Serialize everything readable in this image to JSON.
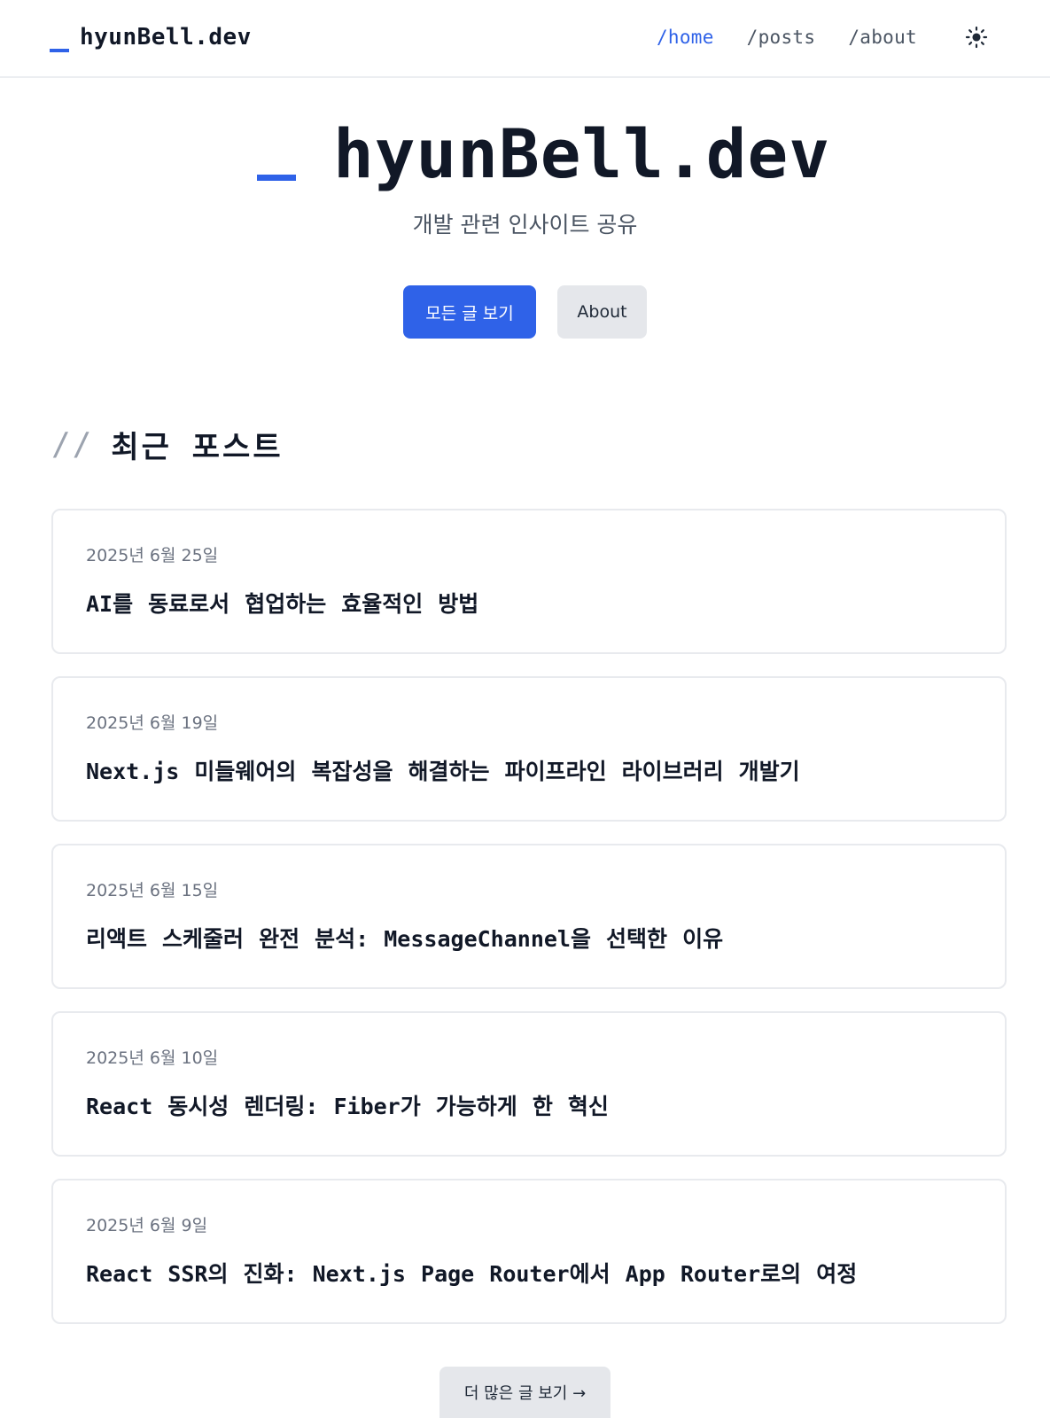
{
  "header": {
    "logo_text": "hyunBell.dev",
    "nav": [
      {
        "label": "/home",
        "active": true
      },
      {
        "label": "/posts",
        "active": false
      },
      {
        "label": "/about",
        "active": false
      }
    ],
    "theme_toggle_icon": "sun-icon"
  },
  "hero": {
    "title": "hyunBell.dev",
    "subtitle": "개발 관련 인사이트 공유",
    "primary_button": "모든 글 보기",
    "secondary_button": "About"
  },
  "recent": {
    "prefix": "//",
    "title": "최근 포스트",
    "posts": [
      {
        "date": "2025년 6월 25일",
        "title": "AI를 동료로서 협업하는 효율적인 방법"
      },
      {
        "date": "2025년 6월 19일",
        "title": "Next.js 미들웨어의 복잡성을 해결하는 파이프라인 라이브러리 개발기"
      },
      {
        "date": "2025년 6월 15일",
        "title": "리액트 스케줄러 완전 분석: MessageChannel을 선택한 이유"
      },
      {
        "date": "2025년 6월 10일",
        "title": "React 동시성 렌더링: Fiber가 가능하게 한 혁신"
      },
      {
        "date": "2025년 6월 9일",
        "title": "React SSR의 진화: Next.js Page Router에서 App Router로의 여정"
      }
    ],
    "more_button": "더 많은 글 보기 →"
  },
  "colors": {
    "accent": "#2f62e8",
    "text": "#111827",
    "muted": "#6b7280",
    "border": "#e8eaee",
    "secondary_bg": "#e5e7eb"
  }
}
